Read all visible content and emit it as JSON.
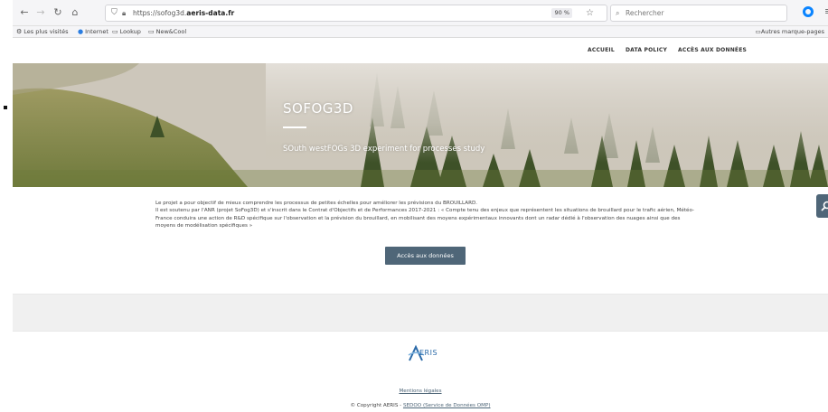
{
  "browser": {
    "url_prefix": "https://sofog3d.",
    "url_domain": "aeris-data.fr",
    "zoom": "90 %",
    "search_placeholder": "Rechercher"
  },
  "bookmarks": {
    "items": [
      "Les plus visités",
      "Internet",
      "Lookup",
      "New&Cool"
    ],
    "other": "Autres marque-pages"
  },
  "topnav": {
    "items": [
      "ACCUEIL",
      "DATA POLICY",
      "ACCÈS AUX DONNÉES"
    ]
  },
  "hero": {
    "title": "SOFOG3D",
    "subtitle": "SOuth westFOGs 3D experiment for processes study"
  },
  "content": {
    "line1": "Le projet a pour objectif de mieux comprendre les processus de petites échelles pour améliorer les prévisions du BROUILLARD.",
    "line2": "Il est soutenu par l'ANR (projet SoFog3D) et s'inscrit dans le Contrat d'Objectifs et de Performances 2017-2021 : « Compte tenu des enjeux que représentent les situations de brouillard pour le trafic aérien, Météo-France conduira une action de R&D spécifique sur l'observation et la prévision du brouillard, en mobilisant des moyens expérimentaux innovants dont un radar dédié à l'observation des nuages ainsi que des moyens de modélisation spécifiques »",
    "button": "Accès aux données"
  },
  "footer": {
    "logo_text": "ERIS",
    "mentions": "Mentions légales",
    "copyright": "© Copyright AERIS - ",
    "copyright_link": "SEDOO (Service de Données OMP)"
  },
  "colors": {
    "accent": "#4f6678",
    "firefox_blue": "#0a84ff",
    "logo_blue": "#2b6aa8"
  }
}
